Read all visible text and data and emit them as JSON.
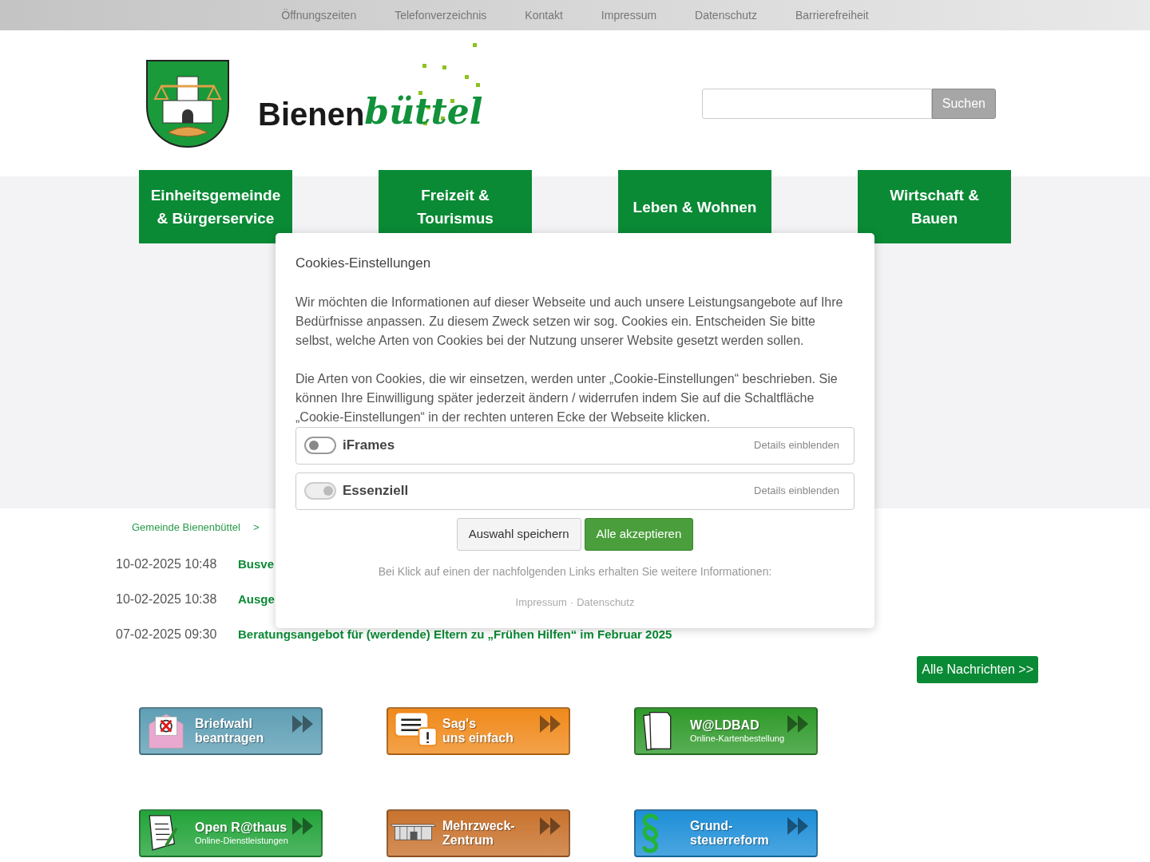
{
  "top_links": [
    "Öffnungszeiten",
    "Telefonverzeichnis",
    "Kontakt",
    "Impressum",
    "Datenschutz",
    "Barrierefreiheit"
  ],
  "logo": {
    "left": "Bienen",
    "right": "büttel"
  },
  "search": {
    "button": "Suchen"
  },
  "main_nav": [
    {
      "label": "Einheitsgemeinde & Bürgerservice"
    },
    {
      "label": "Freizeit & Tourismus"
    },
    {
      "label": "Leben & Wohnen"
    },
    {
      "label": "Wirtschaft & Bauen"
    }
  ],
  "breadcrumb": {
    "items": [
      "Gemeinde Bienenbüttel"
    ],
    "separator": ">"
  },
  "news": [
    {
      "date": "10-02-2025 10:48",
      "title": "Busve"
    },
    {
      "date": "10-02-2025 10:38",
      "title": "Ausge"
    },
    {
      "date": "07-02-2025 09:30",
      "title": "Beratungsangebot für (werdende) Eltern zu „Frühen Hilfen“ im Februar 2025"
    }
  ],
  "all_news_button": "Alle Nachrichten >>",
  "banners": [
    {
      "kind": "envelope",
      "color": "#5f9fb5",
      "lines": [
        "Briefwahl",
        "beantragen"
      ]
    },
    {
      "kind": "speech",
      "color": "#f08a1c",
      "lines": [
        "Sag's",
        "uns einfach"
      ]
    },
    {
      "kind": "papers",
      "color": "#2f9a2a",
      "lines": [
        "W@LDBAD"
      ],
      "subtitle": "Online-Kartenbestellung"
    },
    {
      "kind": "form",
      "color": "#23a43a",
      "lines": [
        "Open R@thaus"
      ],
      "subtitle": "Online-Dienstleistungen"
    },
    {
      "kind": "building",
      "color": "#c9732e",
      "lines": [
        "Mehrzweck-",
        "Zentrum"
      ]
    },
    {
      "kind": "paragraph",
      "color": "#1e8fd8",
      "lines": [
        "Grund-",
        "steuerreform"
      ]
    }
  ],
  "cookie_modal": {
    "title": "Cookies-Einstellungen",
    "paragraphs": [
      "Wir möchten die Informationen auf dieser Webseite und auch unsere Leistungsangebote auf Ihre Bedürfnisse anpassen. Zu diesem Zweck setzen wir sog. Cookies ein. Entscheiden Sie bitte selbst, welche Arten von Cookies bei der Nutzung unserer Website gesetzt werden sollen.",
      "Die Arten von Cookies, die wir einsetzen, werden unter „Cookie-Einstellungen“ beschrieben. Sie können Ihre Einwilligung später jederzeit ändern / widerrufen indem Sie auf die Schaltfläche „Cookie-Einstellungen“ in der rechten unteren Ecke der Webseite klicken."
    ],
    "categories": [
      {
        "label": "iFrames",
        "on": false,
        "disabled": false,
        "details": "Details einblenden"
      },
      {
        "label": "Essenziell",
        "on": true,
        "disabled": true,
        "details": "Details einblenden"
      }
    ],
    "save_button": "Auswahl speichern",
    "accept_button": "Alle akzeptieren",
    "info": "Bei Klick auf einen der nachfolgenden Links erhalten Sie weitere Informationen:",
    "links": [
      "Impressum",
      "Datenschutz"
    ],
    "link_separator": "·"
  }
}
